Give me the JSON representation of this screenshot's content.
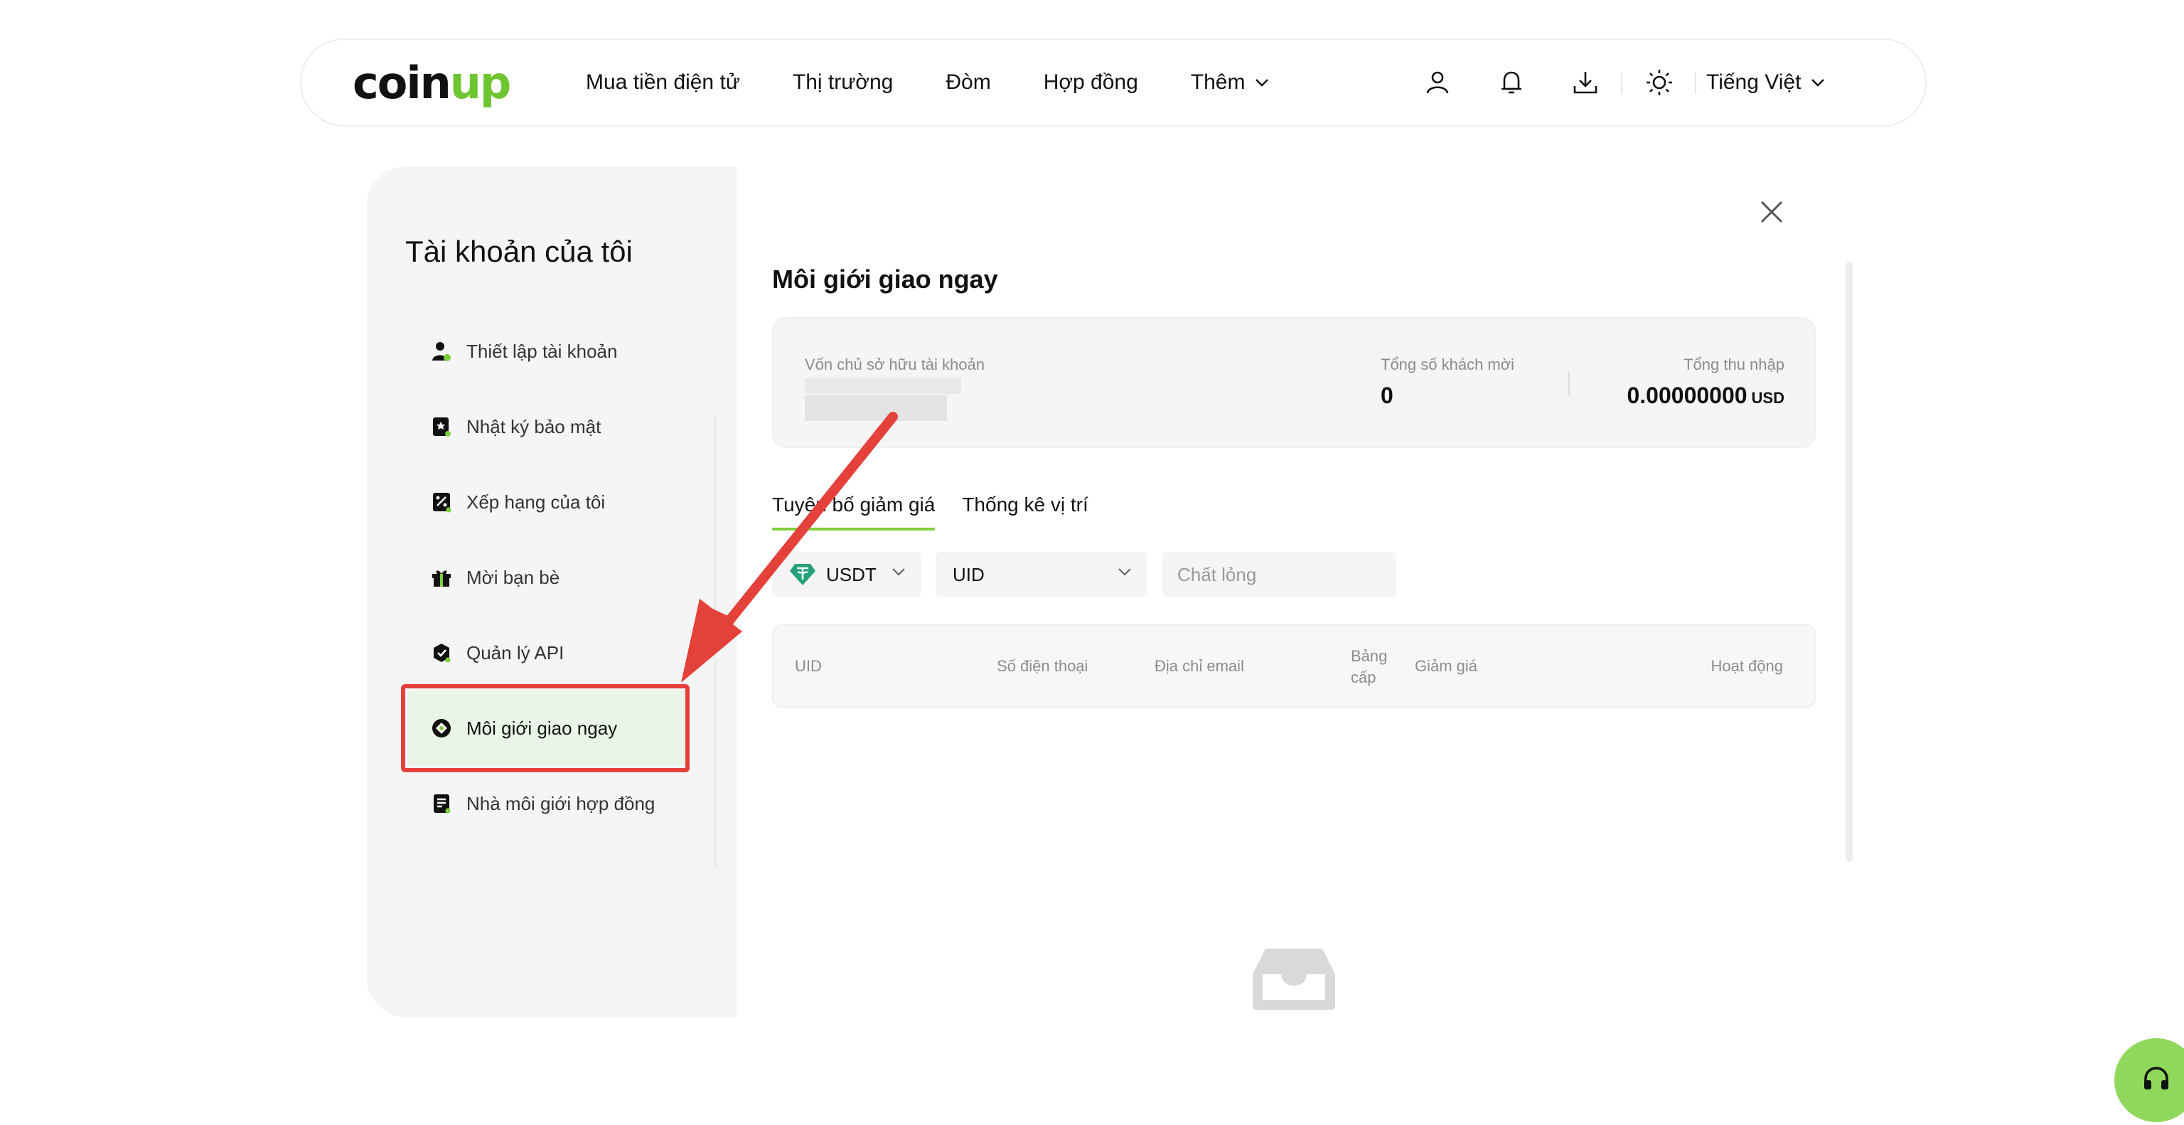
{
  "header": {
    "logo_text_1": "coin",
    "logo_text_2": "up",
    "nav": [
      {
        "label": "Mua tiền điện tử"
      },
      {
        "label": "Thị trường"
      },
      {
        "label": "Đòm"
      },
      {
        "label": "Hợp đồng"
      },
      {
        "label": "Thêm"
      }
    ],
    "icons": [
      "user-icon",
      "bell-icon",
      "download-icon",
      "sun-icon"
    ],
    "language": "Tiếng Việt"
  },
  "sidebar": {
    "title": "Tài khoản của tôi",
    "items": [
      {
        "label": "Thiết lập tài khoản",
        "icon": "user-settings-icon"
      },
      {
        "label": "Nhật ký bảo mật",
        "icon": "security-log-icon"
      },
      {
        "label": "Xếp hạng của tôi",
        "icon": "ranking-icon"
      },
      {
        "label": "Mời bạn bè",
        "icon": "gift-icon"
      },
      {
        "label": "Quản lý API",
        "icon": "api-icon"
      },
      {
        "label": "Môi giới giao ngay",
        "icon": "spot-broker-icon",
        "active": true
      },
      {
        "label": "Nhà môi giới hợp đồng",
        "icon": "contract-broker-icon"
      }
    ]
  },
  "main": {
    "title": "Môi giới giao ngay",
    "summary": {
      "owner_label": "Vốn chủ sở hữu tài khoản",
      "invites_label": "Tổng số khách mời",
      "invites_value": "0",
      "income_label": "Tổng thu nhập",
      "income_value": "0.00000000",
      "income_unit": "USD"
    },
    "tabs": [
      {
        "label": "Tuyên bố giảm giá",
        "active": true
      },
      {
        "label": "Thống kê vị trí"
      }
    ],
    "filters": {
      "coin": "USDT",
      "id_type": "UID",
      "search_placeholder": "Chất lỏng"
    },
    "table_columns": [
      "UID",
      "Số điện thoại",
      "Địa chỉ email",
      "Bảng",
      "cấp",
      "Giảm giá",
      "Hoạt động"
    ]
  },
  "colors": {
    "accent_green": "#7ccf3c",
    "annotation_red": "#e5413b",
    "support_green": "#8fd85b"
  }
}
